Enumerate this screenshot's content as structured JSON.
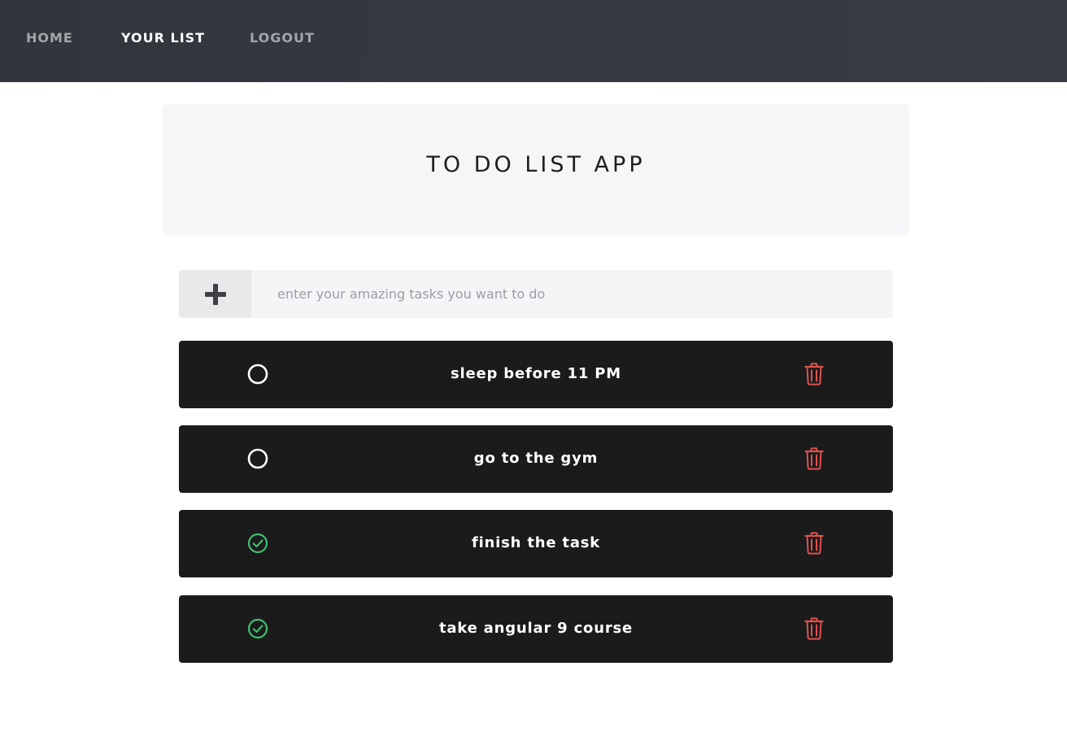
{
  "nav": {
    "home": "HOME",
    "your_list": "YOUR LIST",
    "logout": "LOGOUT"
  },
  "hero": {
    "title": "TO DO LIST APP"
  },
  "add_task": {
    "button_icon": "plus-icon",
    "placeholder": "enter your amazing tasks you want to do",
    "value": ""
  },
  "tasks": [
    {
      "text": "sleep before 11 PM",
      "completed": false
    },
    {
      "text": "go to the gym",
      "completed": false
    },
    {
      "text": "finish the task",
      "completed": true
    },
    {
      "text": "take angular 9 course",
      "completed": true
    }
  ],
  "colors": {
    "navbar": "#353941",
    "task_bg": "#1b1b1c",
    "check_done": "#3fbf6f",
    "delete": "#e0524e"
  }
}
